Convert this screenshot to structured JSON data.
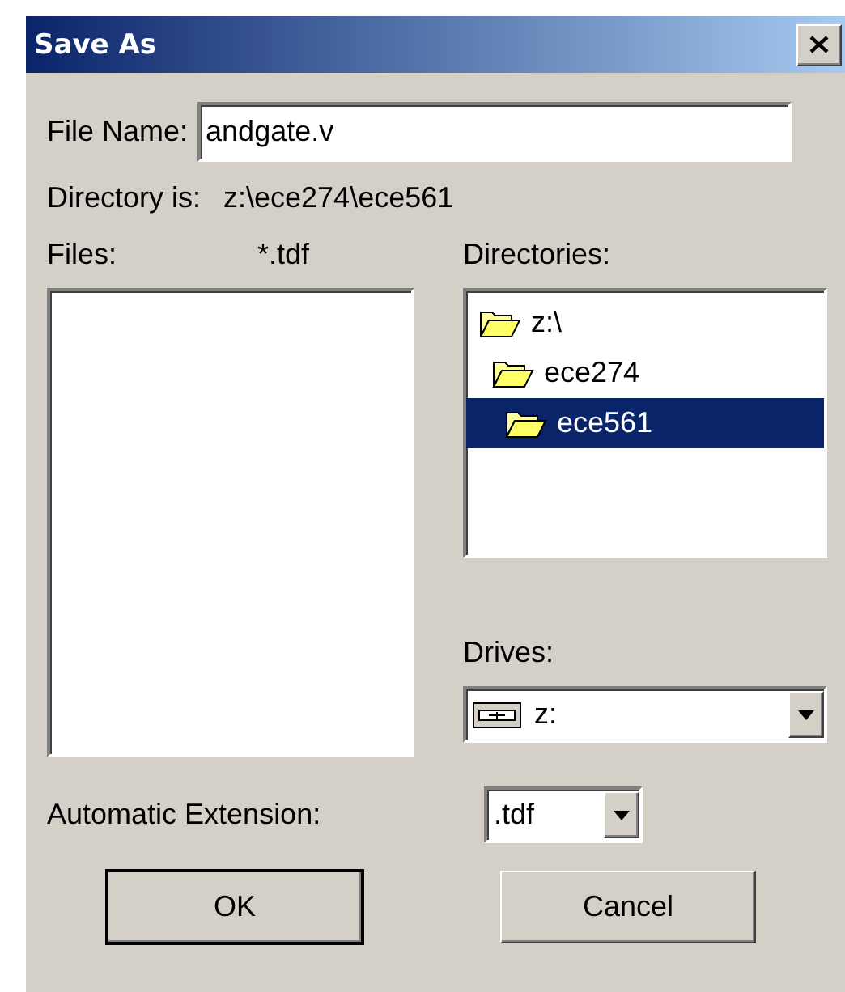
{
  "window": {
    "title": "Save As"
  },
  "file_name": {
    "label": "File Name:",
    "value": "andgate.v"
  },
  "directory": {
    "label": "Directory is:",
    "path": "z:\\ece274\\ece561"
  },
  "files": {
    "label": "Files:",
    "filter": "*.tdf"
  },
  "directories": {
    "label": "Directories:",
    "items": [
      {
        "name": "z:\\",
        "selected": false,
        "children": [
          {
            "name": "ece274",
            "selected": false,
            "children": [
              {
                "name": "ece561",
                "selected": true
              }
            ]
          }
        ]
      }
    ]
  },
  "drives": {
    "label": "Drives:",
    "value": "z:"
  },
  "extension": {
    "label": "Automatic Extension:",
    "value": ".tdf"
  },
  "buttons": [
    {
      "label": "OK",
      "default": true
    },
    {
      "label": "Cancel",
      "default": false
    }
  ]
}
